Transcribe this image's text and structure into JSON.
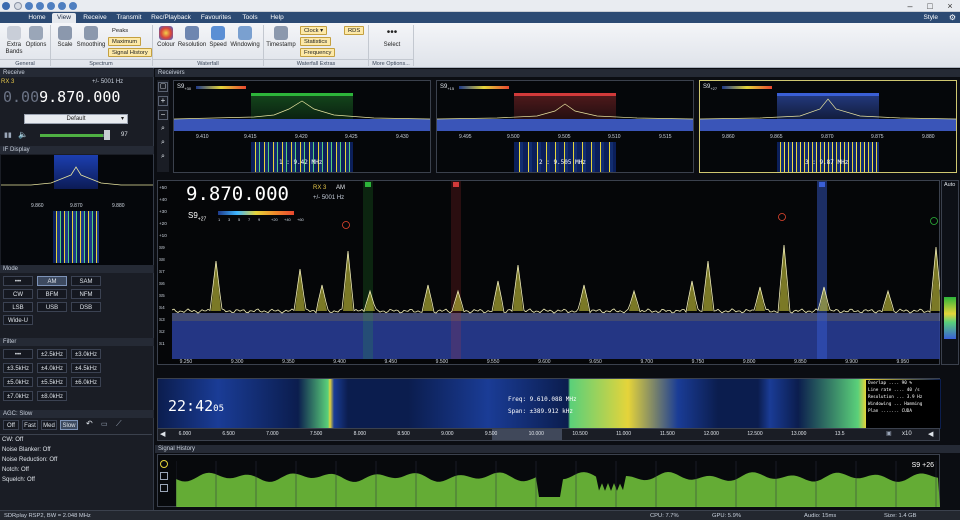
{
  "menu": {
    "tabs": [
      "Home",
      "View",
      "Receive",
      "Transmit",
      "Rec/Playback",
      "Favourites",
      "Tools",
      "Help"
    ],
    "active": "View",
    "style_label": "Style"
  },
  "ribbon": {
    "general": {
      "label": "General",
      "buttons": [
        "Extra Bands",
        "Options"
      ]
    },
    "spectrum": {
      "label": "Spectrum",
      "buttons": [
        "Scale",
        "Smoothing"
      ],
      "peaks": "Peaks",
      "maximum": "Maximum",
      "signal_history": "Signal History"
    },
    "waterfall": {
      "label": "Waterfall",
      "buttons": [
        "Colour",
        "Resolution",
        "Speed",
        "Windowing"
      ]
    },
    "extras": {
      "label": "Waterfall Extras",
      "timestamp": "Timestamp",
      "clock": "Clock",
      "statistics": "Statistics",
      "frequency": "Frequency",
      "rds": "RDS"
    },
    "more": {
      "label": "More Options...",
      "select": "Select",
      "dots": "•••"
    }
  },
  "receive": {
    "title": "Receive",
    "rx": "RX 3",
    "offset": "+/- 5001 Hz",
    "freq_dim": "0.00",
    "freq_main": "9.870.000",
    "preset": "Default",
    "volume": "97"
  },
  "if": {
    "title": "IF Display",
    "ticks": [
      "9.860",
      "9.870",
      "9.880"
    ]
  },
  "mode": {
    "title": "Mode",
    "buttons": [
      "•••",
      "AM",
      "SAM",
      "CW",
      "BFM",
      "NFM",
      "LSB",
      "USB",
      "DSB",
      "Wide-U"
    ],
    "selected": "AM"
  },
  "filter": {
    "title": "Filter",
    "buttons": [
      "•••",
      "±2.5kHz",
      "±3.0kHz",
      "±3.5kHz",
      "±4.0kHz",
      "±4.5kHz",
      "±5.0kHz",
      "±5.5kHz",
      "±6.0kHz",
      "±7.0kHz",
      "±8.0kHz"
    ]
  },
  "agc": {
    "title": "AGC: Slow",
    "buttons": [
      "Off",
      "Fast",
      "Med",
      "Slow"
    ],
    "selected": "Slow"
  },
  "dsp": [
    "CW: Off",
    "Noise Blanker: Off",
    "Noise Reduction: Off",
    "Notch: Off",
    "Squelch: Off"
  ],
  "receivers": {
    "title": "Receivers"
  },
  "minis": [
    {
      "ticks": [
        "9.410",
        "9.415",
        "9.420",
        "9.425",
        "9.430"
      ],
      "label": "1 : 9.42 MHz",
      "s": "S9",
      "sub": "+30",
      "color": "#2db53a"
    },
    {
      "ticks": [
        "9.495",
        "9.500",
        "9.505",
        "9.510",
        "9.515"
      ],
      "label": "2 : 9.505 MHz",
      "s": "S9",
      "sub": "+15",
      "color": "#d23a3a"
    },
    {
      "ticks": [
        "9.860",
        "9.865",
        "9.870",
        "9.875",
        "9.880"
      ],
      "label": "3 : 9.87 MHz",
      "s": "S9",
      "sub": "+27",
      "color": "#3a5fd6"
    }
  ],
  "main": {
    "freq": "9.870.000",
    "rx": "RX 3",
    "mode": "AM",
    "offset": "+/- 5001 Hz",
    "s": "S9",
    "sub": "+27",
    "auto": "Auto",
    "yticks": [
      "+50",
      "+40",
      "+30",
      "+20",
      "+10",
      "S9",
      "S8",
      "S7",
      "S6",
      "S5",
      "S4",
      "S3",
      "S2",
      "S1"
    ],
    "xticks": [
      "9.250",
      "9.300",
      "9.350",
      "9.400",
      "9.450",
      "9.500",
      "9.550",
      "9.600",
      "9.650",
      "9.700",
      "9.750",
      "9.800",
      "9.850",
      "9.900",
      "9.950"
    ],
    "scale_ticks": [
      "1",
      "3",
      "5",
      "7",
      "9",
      "+20",
      "+40",
      "+60"
    ],
    "markers": [
      "1",
      "2",
      "3"
    ]
  },
  "waterfall": {
    "clock_hm": "22:42",
    "clock_s": "05",
    "freq_line": "Freq: 9.610.088 MHz",
    "span_line": "Span:  ±389.912 kHz",
    "stats": [
      "Overlap .... 90 %",
      "Line rate .... 40 /s",
      "Resolution ... 3.9 Hz",
      "Windowing ... Hamming",
      "Plan ....... CUDA"
    ],
    "overview": [
      "6.000",
      "6.500",
      "7.000",
      "7.500",
      "8.000",
      "8.500",
      "9.000",
      "9.500",
      "10.000",
      "10.500",
      "11.000",
      "11.500",
      "12.000",
      "12.500",
      "13.000",
      "13.5"
    ],
    "zoom": "x10"
  },
  "history": {
    "title": "Signal History",
    "s": "S9",
    "sub": "+26"
  },
  "status": {
    "device": "SDRplay RSP2, BW = 2.048 MHz",
    "cpu": "CPU: 7.7%",
    "gpu": "GPU: 5.9%",
    "audio": "Audio: 15ms",
    "size": "Size: 1.4 GB"
  }
}
